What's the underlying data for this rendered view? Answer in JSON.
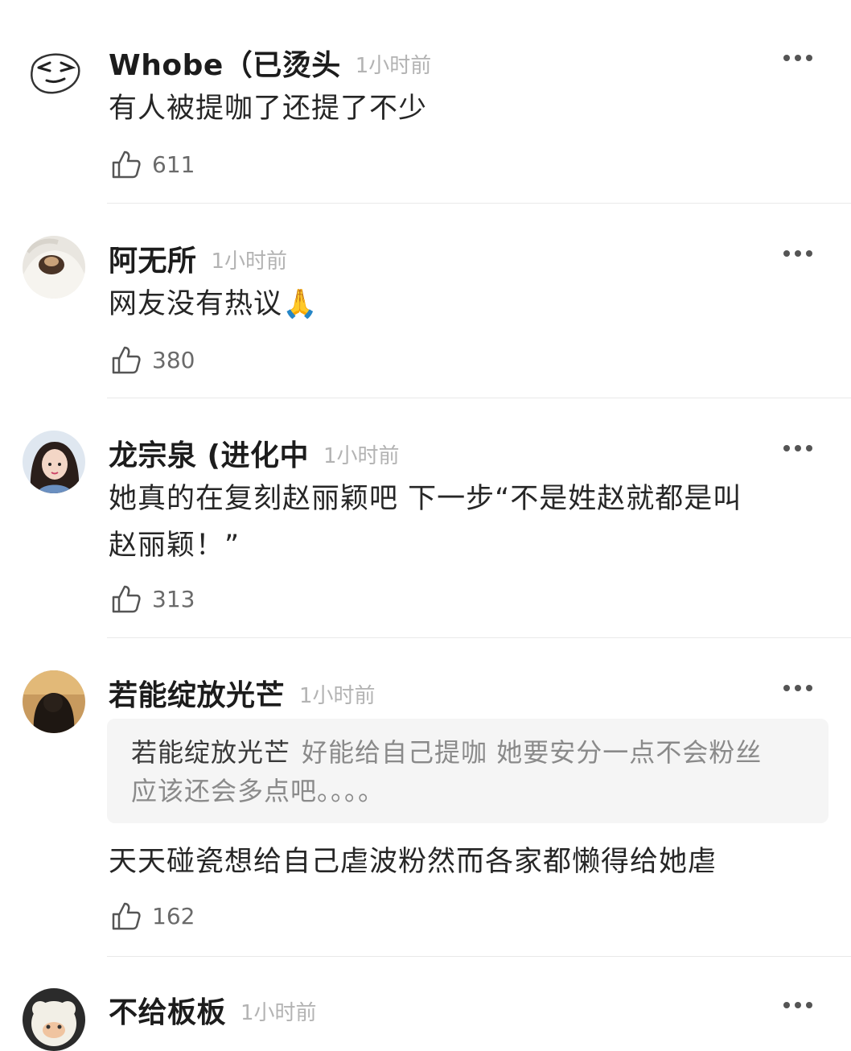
{
  "icons": {
    "more": "ellipsis-icon",
    "like": "thumbs-up-icon",
    "emoji_pray": "folded-hands-emoji"
  },
  "comments": [
    {
      "name": "Whobe（已烫头",
      "time": "1小时前",
      "text": "有人被提咖了还提了不少",
      "likes": "611"
    },
    {
      "name": "阿无所",
      "time": "1小时前",
      "text": "网友没有热议",
      "emoji": "🙏",
      "likes": "380"
    },
    {
      "name": "龙宗泉 (进化中",
      "time": "1小时前",
      "text_line1": "她真的在复刻赵丽颖吧 下一步“不是姓赵就都是叫",
      "text_line2": "赵丽颖！”",
      "likes": "313"
    },
    {
      "name": "若能绽放光芒",
      "time": "1小时前",
      "quote": {
        "name": "若能绽放光芒",
        "line1": "好能给自己提咖 她要安分一点不会粉丝",
        "line2": "应该还会多点吧。。。。"
      },
      "text": "天天碰瓷想给自己虐波粉然而各家都懒得给她虐",
      "likes": "162"
    },
    {
      "name": "不给板板",
      "time": "1小时前"
    }
  ],
  "colors": {
    "time": "#b3b3b3",
    "divider": "#e9e9e9",
    "quote_bg": "#f5f5f5"
  }
}
